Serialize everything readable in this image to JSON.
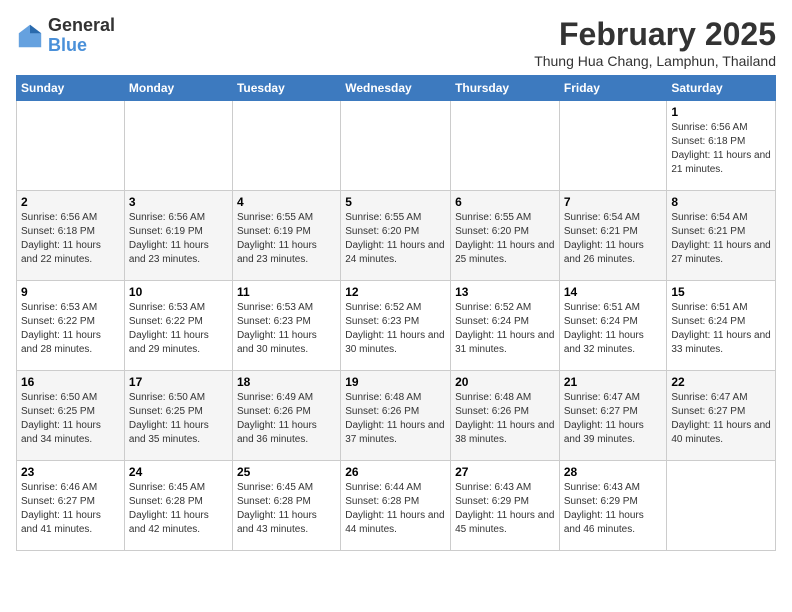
{
  "header": {
    "logo_general": "General",
    "logo_blue": "Blue",
    "main_title": "February 2025",
    "sub_title": "Thung Hua Chang, Lamphun, Thailand"
  },
  "calendar": {
    "days_of_week": [
      "Sunday",
      "Monday",
      "Tuesday",
      "Wednesday",
      "Thursday",
      "Friday",
      "Saturday"
    ],
    "weeks": [
      [
        {
          "day": "",
          "info": ""
        },
        {
          "day": "",
          "info": ""
        },
        {
          "day": "",
          "info": ""
        },
        {
          "day": "",
          "info": ""
        },
        {
          "day": "",
          "info": ""
        },
        {
          "day": "",
          "info": ""
        },
        {
          "day": "1",
          "info": "Sunrise: 6:56 AM\nSunset: 6:18 PM\nDaylight: 11 hours and 21 minutes."
        }
      ],
      [
        {
          "day": "2",
          "info": "Sunrise: 6:56 AM\nSunset: 6:18 PM\nDaylight: 11 hours and 22 minutes."
        },
        {
          "day": "3",
          "info": "Sunrise: 6:56 AM\nSunset: 6:19 PM\nDaylight: 11 hours and 23 minutes."
        },
        {
          "day": "4",
          "info": "Sunrise: 6:55 AM\nSunset: 6:19 PM\nDaylight: 11 hours and 23 minutes."
        },
        {
          "day": "5",
          "info": "Sunrise: 6:55 AM\nSunset: 6:20 PM\nDaylight: 11 hours and 24 minutes."
        },
        {
          "day": "6",
          "info": "Sunrise: 6:55 AM\nSunset: 6:20 PM\nDaylight: 11 hours and 25 minutes."
        },
        {
          "day": "7",
          "info": "Sunrise: 6:54 AM\nSunset: 6:21 PM\nDaylight: 11 hours and 26 minutes."
        },
        {
          "day": "8",
          "info": "Sunrise: 6:54 AM\nSunset: 6:21 PM\nDaylight: 11 hours and 27 minutes."
        }
      ],
      [
        {
          "day": "9",
          "info": "Sunrise: 6:53 AM\nSunset: 6:22 PM\nDaylight: 11 hours and 28 minutes."
        },
        {
          "day": "10",
          "info": "Sunrise: 6:53 AM\nSunset: 6:22 PM\nDaylight: 11 hours and 29 minutes."
        },
        {
          "day": "11",
          "info": "Sunrise: 6:53 AM\nSunset: 6:23 PM\nDaylight: 11 hours and 30 minutes."
        },
        {
          "day": "12",
          "info": "Sunrise: 6:52 AM\nSunset: 6:23 PM\nDaylight: 11 hours and 30 minutes."
        },
        {
          "day": "13",
          "info": "Sunrise: 6:52 AM\nSunset: 6:24 PM\nDaylight: 11 hours and 31 minutes."
        },
        {
          "day": "14",
          "info": "Sunrise: 6:51 AM\nSunset: 6:24 PM\nDaylight: 11 hours and 32 minutes."
        },
        {
          "day": "15",
          "info": "Sunrise: 6:51 AM\nSunset: 6:24 PM\nDaylight: 11 hours and 33 minutes."
        }
      ],
      [
        {
          "day": "16",
          "info": "Sunrise: 6:50 AM\nSunset: 6:25 PM\nDaylight: 11 hours and 34 minutes."
        },
        {
          "day": "17",
          "info": "Sunrise: 6:50 AM\nSunset: 6:25 PM\nDaylight: 11 hours and 35 minutes."
        },
        {
          "day": "18",
          "info": "Sunrise: 6:49 AM\nSunset: 6:26 PM\nDaylight: 11 hours and 36 minutes."
        },
        {
          "day": "19",
          "info": "Sunrise: 6:48 AM\nSunset: 6:26 PM\nDaylight: 11 hours and 37 minutes."
        },
        {
          "day": "20",
          "info": "Sunrise: 6:48 AM\nSunset: 6:26 PM\nDaylight: 11 hours and 38 minutes."
        },
        {
          "day": "21",
          "info": "Sunrise: 6:47 AM\nSunset: 6:27 PM\nDaylight: 11 hours and 39 minutes."
        },
        {
          "day": "22",
          "info": "Sunrise: 6:47 AM\nSunset: 6:27 PM\nDaylight: 11 hours and 40 minutes."
        }
      ],
      [
        {
          "day": "23",
          "info": "Sunrise: 6:46 AM\nSunset: 6:27 PM\nDaylight: 11 hours and 41 minutes."
        },
        {
          "day": "24",
          "info": "Sunrise: 6:45 AM\nSunset: 6:28 PM\nDaylight: 11 hours and 42 minutes."
        },
        {
          "day": "25",
          "info": "Sunrise: 6:45 AM\nSunset: 6:28 PM\nDaylight: 11 hours and 43 minutes."
        },
        {
          "day": "26",
          "info": "Sunrise: 6:44 AM\nSunset: 6:28 PM\nDaylight: 11 hours and 44 minutes."
        },
        {
          "day": "27",
          "info": "Sunrise: 6:43 AM\nSunset: 6:29 PM\nDaylight: 11 hours and 45 minutes."
        },
        {
          "day": "28",
          "info": "Sunrise: 6:43 AM\nSunset: 6:29 PM\nDaylight: 11 hours and 46 minutes."
        },
        {
          "day": "",
          "info": ""
        }
      ]
    ]
  }
}
